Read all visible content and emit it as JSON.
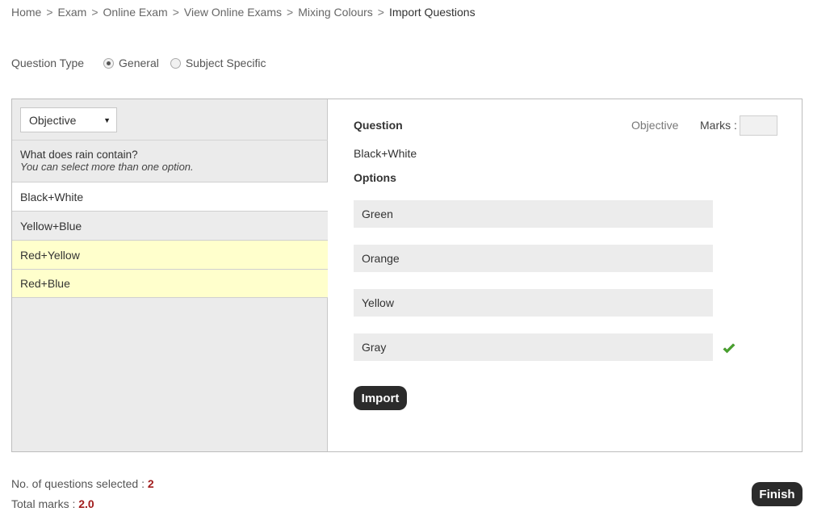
{
  "breadcrumb": {
    "items": [
      "Home",
      "Exam",
      "Online Exam",
      "View Online Exams",
      "Mixing Colours"
    ],
    "current": "Import Questions",
    "separator": ">"
  },
  "question_type": {
    "label": "Question Type",
    "options": [
      "General",
      "Subject Specific"
    ],
    "selected": "General"
  },
  "filter": {
    "selected": "Objective",
    "caret": "▼"
  },
  "left_question": {
    "text": "What does rain contain?",
    "hint": "You can select more than one option."
  },
  "left_options": [
    {
      "label": "Black+White",
      "state": "white"
    },
    {
      "label": "Yellow+Blue",
      "state": "gray"
    },
    {
      "label": "Red+Yellow",
      "state": "yellow"
    },
    {
      "label": "Red+Blue",
      "state": "yellow"
    }
  ],
  "detail": {
    "question_heading": "Question",
    "type": "Objective",
    "marks_label": "Marks :",
    "marks_value": "",
    "question_text": "Black+White",
    "options_heading": "Options",
    "options": [
      "Green",
      "Orange",
      "Yellow",
      "Gray"
    ],
    "correct_option": "Gray",
    "check_icon": "check-icon",
    "check_color": "#4aa52e"
  },
  "buttons": {
    "import": "Import",
    "finish": "Finish"
  },
  "summary": {
    "selected_label": "No. of questions selected :",
    "selected_value": "2",
    "marks_label": "Total marks :",
    "marks_value": "2.0"
  },
  "colors": {
    "accent_value": "#a11d1d",
    "button_bg": "#2b2b2b",
    "highlight_yellow": "#ffffcc"
  }
}
